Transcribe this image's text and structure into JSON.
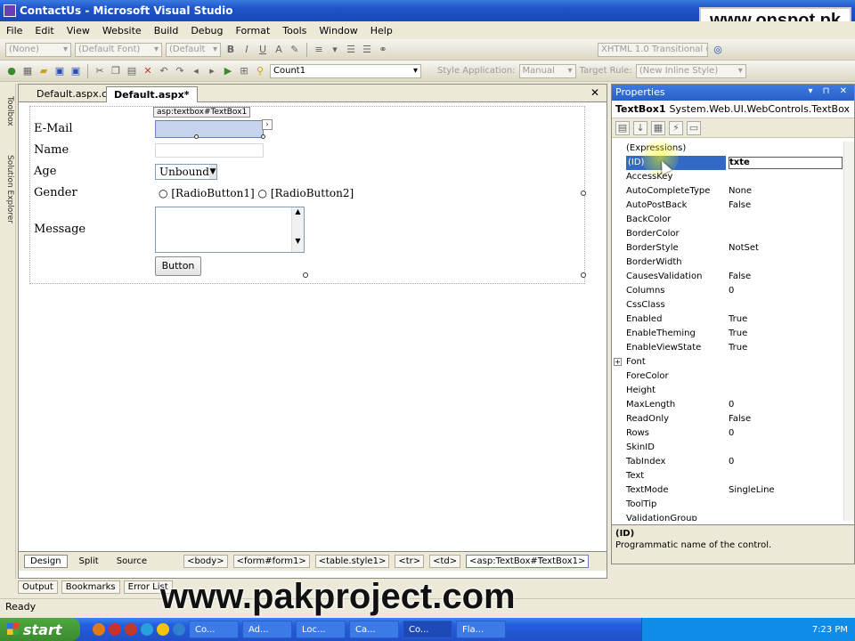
{
  "window": {
    "title": "ContactUs - Microsoft Visual Studio"
  },
  "watermarks": {
    "top": "www.onspot.pk",
    "bottom": "www.pakproject.com"
  },
  "menu": [
    "File",
    "Edit",
    "View",
    "Website",
    "Build",
    "Debug",
    "Format",
    "Tools",
    "Window",
    "Help"
  ],
  "toolbar1": {
    "block_format": "(None)",
    "font": "(Default Font)",
    "font_size": "(Default",
    "doctype": "XHTML 1.0 Transitional (",
    "bold": "B",
    "italic": "I",
    "underline": "U"
  },
  "toolbar2": {
    "find_value": "Count1",
    "style_application_label": "Style Application:",
    "style_application_value": "Manual",
    "target_rule_label": "Target Rule:",
    "target_rule_value": "(New Inline Style)"
  },
  "left_strip": {
    "toolbox": "Toolbox",
    "solution_explorer": "Solution Explorer"
  },
  "doc_tabs": [
    {
      "label": "Default.aspx.cs"
    },
    {
      "label": "Default.aspx*"
    }
  ],
  "designer": {
    "tag_tooltip": "asp:textbox#TextBox1",
    "labels": {
      "email": "E-Mail",
      "name": "Name",
      "age": "Age",
      "gender": "Gender",
      "message": "Message"
    },
    "age_select": "Unbound",
    "radio1": "[RadioButton1]",
    "radio2": "[RadioButton2]",
    "button": "Button"
  },
  "view_tabs": {
    "design": "Design",
    "split": "Split",
    "source": "Source"
  },
  "breadcrumbs": [
    "<body>",
    "<form#form1>",
    "<table.style1>",
    "<tr>",
    "<td>",
    "<asp:TextBox#TextBox1>"
  ],
  "properties": {
    "title": "Properties",
    "object_name": "TextBox1",
    "object_type": "System.Web.UI.WebControls.TextBox",
    "rows": [
      {
        "name": "(Expressions)",
        "value": ""
      },
      {
        "name": "(ID)",
        "value": "txte"
      },
      {
        "name": "AccessKey",
        "value": ""
      },
      {
        "name": "AutoCompleteType",
        "value": "None"
      },
      {
        "name": "AutoPostBack",
        "value": "False"
      },
      {
        "name": "BackColor",
        "value": ""
      },
      {
        "name": "BorderColor",
        "value": ""
      },
      {
        "name": "BorderStyle",
        "value": "NotSet"
      },
      {
        "name": "BorderWidth",
        "value": ""
      },
      {
        "name": "CausesValidation",
        "value": "False"
      },
      {
        "name": "Columns",
        "value": "0"
      },
      {
        "name": "CssClass",
        "value": ""
      },
      {
        "name": "Enabled",
        "value": "True"
      },
      {
        "name": "EnableTheming",
        "value": "True"
      },
      {
        "name": "EnableViewState",
        "value": "True"
      },
      {
        "name": "Font",
        "value": ""
      },
      {
        "name": "ForeColor",
        "value": ""
      },
      {
        "name": "Height",
        "value": ""
      },
      {
        "name": "MaxLength",
        "value": "0"
      },
      {
        "name": "ReadOnly",
        "value": "False"
      },
      {
        "name": "Rows",
        "value": "0"
      },
      {
        "name": "SkinID",
        "value": ""
      },
      {
        "name": "TabIndex",
        "value": "0"
      },
      {
        "name": "Text",
        "value": ""
      },
      {
        "name": "TextMode",
        "value": "SingleLine"
      },
      {
        "name": "ToolTip",
        "value": ""
      },
      {
        "name": "ValidationGroup",
        "value": ""
      }
    ],
    "desc_title": "(ID)",
    "desc_text": "Programmatic name of the control."
  },
  "bottom_tabs": [
    "Output",
    "Bookmarks",
    "Error List"
  ],
  "status": "Ready",
  "taskbar": {
    "start": "start",
    "tasks": [
      "Co...",
      "Ad...",
      "Loc...",
      "Ca...",
      "Co...",
      "Fla..."
    ],
    "clock": "7:23 PM"
  }
}
